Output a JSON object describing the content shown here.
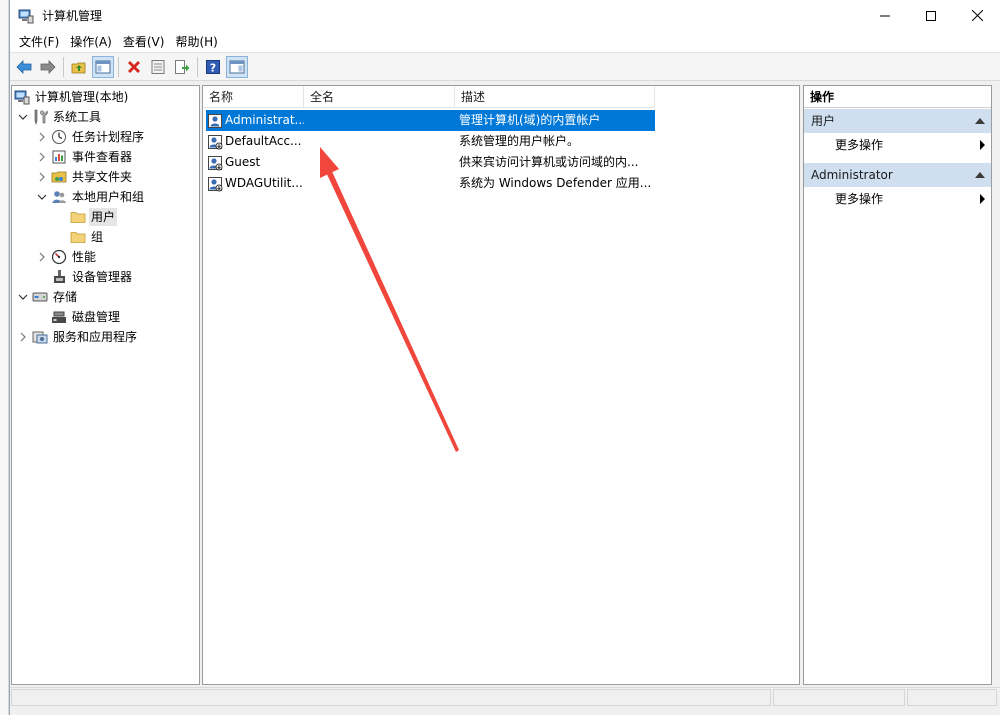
{
  "window": {
    "title": "计算机管理"
  },
  "menu": [
    {
      "label": "文件(F)"
    },
    {
      "label": "操作(A)"
    },
    {
      "label": "查看(V)"
    },
    {
      "label": "帮助(H)"
    }
  ],
  "toolbar": {
    "icons": [
      "back-arrow-icon",
      "forward-arrow-icon",
      "up-folder-icon",
      "show-hide-tree-icon",
      "delete-icon",
      "properties-icon",
      "export-list-icon",
      "help-icon",
      "action-pane-icon"
    ]
  },
  "tree": {
    "root": "计算机管理(本地)",
    "system_tools": "系统工具",
    "task_scheduler": "任务计划程序",
    "event_viewer": "事件查看器",
    "shared_folders": "共享文件夹",
    "local_users": "本地用户和组",
    "users": "用户",
    "groups": "组",
    "performance": "性能",
    "device_manager": "设备管理器",
    "storage": "存储",
    "disk_mgmt": "磁盘管理",
    "services_apps": "服务和应用程序"
  },
  "list": {
    "columns": [
      "名称",
      "全名",
      "描述"
    ],
    "rows": [
      {
        "name": "Administrat...",
        "fullname": "",
        "desc": "管理计算机(域)的内置帐户"
      },
      {
        "name": "DefaultAcc...",
        "fullname": "",
        "desc": "系统管理的用户帐户。"
      },
      {
        "name": "Guest",
        "fullname": "",
        "desc": "供来宾访问计算机或访问域的内..."
      },
      {
        "name": "WDAGUtilit...",
        "fullname": "",
        "desc": "系统为 Windows Defender 应用..."
      }
    ]
  },
  "actions": {
    "title": "操作",
    "sections": [
      {
        "label": "用户",
        "item": "更多操作"
      },
      {
        "label": "Administrator",
        "item": "更多操作"
      }
    ]
  },
  "colors": {
    "selection": "#0078d7",
    "actions_header": "#cfdff0",
    "annotation_arrow": "#f0463c"
  }
}
